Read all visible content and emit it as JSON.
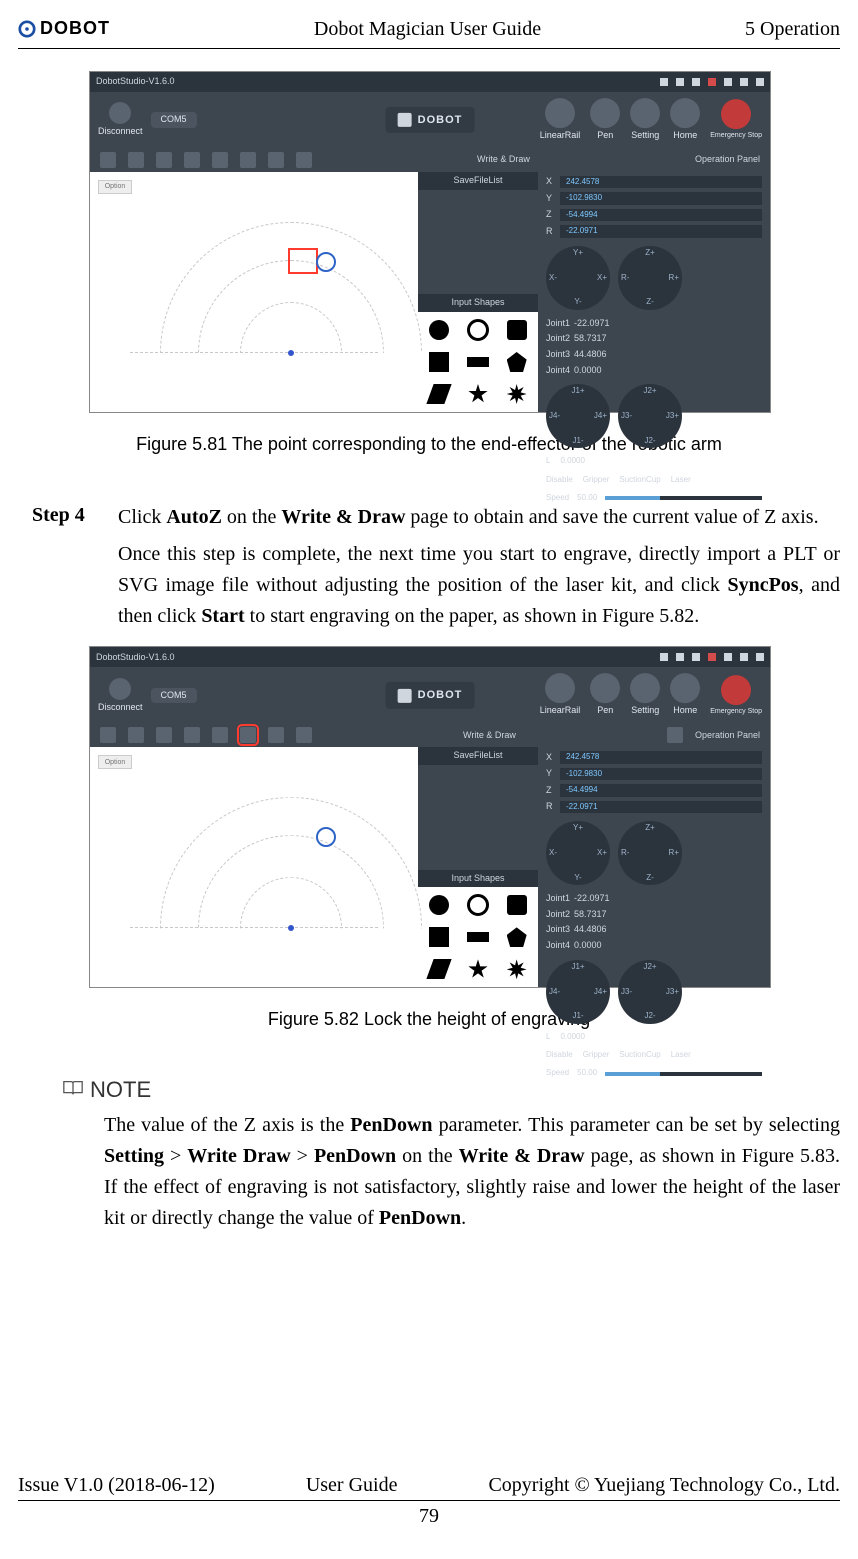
{
  "header": {
    "logo_text": "DOBOT",
    "center": "Dobot Magician User Guide",
    "right": "5 Operation"
  },
  "figure_581": {
    "caption": "Figure 5.81    The point corresponding to the end-effector of the robotic arm",
    "window_title": "DobotStudio-V1.6.0",
    "brand": "DOBOT",
    "connect_label": "Disconnect",
    "com_label": "COM5",
    "linear_rail": "LinearRail",
    "pen": "Pen",
    "setting": "Setting",
    "home": "Home",
    "stop": "Emergency Stop",
    "subtitle": "Write & Draw",
    "operation_panel": "Operation Panel",
    "tools": [
      "New",
      "Open",
      "Save",
      "SaveAs",
      "Download",
      "AutoZ",
      "SyncPos",
      "Start"
    ],
    "option": "Option",
    "save_file_list": "SaveFileList",
    "input_shapes": "Input Shapes",
    "coords": {
      "X": "242.4578",
      "Y": "-102.9830",
      "Z": "-54.4994",
      "R": "-22.0971"
    },
    "joints": {
      "Joint1": "-22.0971",
      "Joint2": "58.7317",
      "Joint3": "44.4806",
      "Joint4": "0.0000"
    },
    "L": "0.0000",
    "end_effectors": [
      "Gripper",
      "SuctionCup",
      "Laser"
    ],
    "disable": "Disable",
    "speed_label": "Speed",
    "speed_value": "50.00",
    "dial1": {
      "n": "Y+",
      "s": "Y-",
      "w": "X-",
      "e": "X+"
    },
    "dial2": {
      "n": "Z+",
      "s": "Z-",
      "w": "R-",
      "e": "R+"
    },
    "dial3": {
      "n": "J1+",
      "s": "J1-",
      "w": "J4-",
      "e": "J4+"
    },
    "dial4": {
      "n": "J2+",
      "s": "J2-",
      "w": "J3-",
      "e": "J3+"
    }
  },
  "step4": {
    "label": "Step 4",
    "p1_a": "Click ",
    "p1_b": "AutoZ",
    "p1_c": " on the ",
    "p1_d": "Write & Draw",
    "p1_e": " page to obtain and save the current value of Z axis.",
    "p2_a": "Once this step is complete, the next time you start to engrave, directly import a PLT or SVG image file without adjusting the position of the laser kit, and click ",
    "p2_b": "SyncPos",
    "p2_c": ", and then click ",
    "p2_d": "Start",
    "p2_e": " to start engraving on the paper, as shown in Figure 5.82."
  },
  "figure_582": {
    "caption": "Figure 5.82    Lock the height of engraving",
    "window_title": "DobotStudio-V1.6.0",
    "brand": "DOBOT",
    "connect_label": "Disconnect",
    "com_label": "COM5",
    "linear_rail": "LinearRail",
    "pen": "Pen",
    "setting": "Setting",
    "home": "Home",
    "stop": "Emergency Stop",
    "subtitle": "Write & Draw",
    "operation_panel": "Operation Panel",
    "tools": [
      "New",
      "Open",
      "Save",
      "SaveAs",
      "Download",
      "AutoZ",
      "SyncPos",
      "Start"
    ],
    "exit": "Exit",
    "option": "Option",
    "save_file_list": "SaveFileList",
    "input_shapes": "Input Shapes",
    "coords": {
      "X": "242.4578",
      "Y": "-102.9830",
      "Z": "-54.4994",
      "R": "-22.0971"
    },
    "joints": {
      "Joint1": "-22.0971",
      "Joint2": "58.7317",
      "Joint3": "44.4806",
      "Joint4": "0.0000"
    },
    "L": "0.0000",
    "end_effectors": [
      "Gripper",
      "SuctionCup",
      "Laser"
    ],
    "disable": "Disable",
    "speed_label": "Speed",
    "speed_value": "50.00"
  },
  "note": {
    "title": "NOTE",
    "t0": "The value of the Z axis is the ",
    "t1": "PenDown",
    "t2": " parameter. This parameter can be set by selecting ",
    "t3": "Setting",
    "t4": " > ",
    "t5": "Write Draw",
    "t6": " > ",
    "t7": "PenDown",
    "t8": " on the ",
    "t9": "Write & Draw",
    "t10": " page, as shown in Figure 5.83. If the effect of engraving is not satisfactory, slightly raise and lower the height of the laser kit or directly change the value of ",
    "t11": "PenDown",
    "t12": "."
  },
  "footer": {
    "left": "Issue V1.0 (2018-06-12)",
    "center": "User Guide",
    "right": "Copyright © Yuejiang Technology Co., Ltd.",
    "page": "79"
  }
}
